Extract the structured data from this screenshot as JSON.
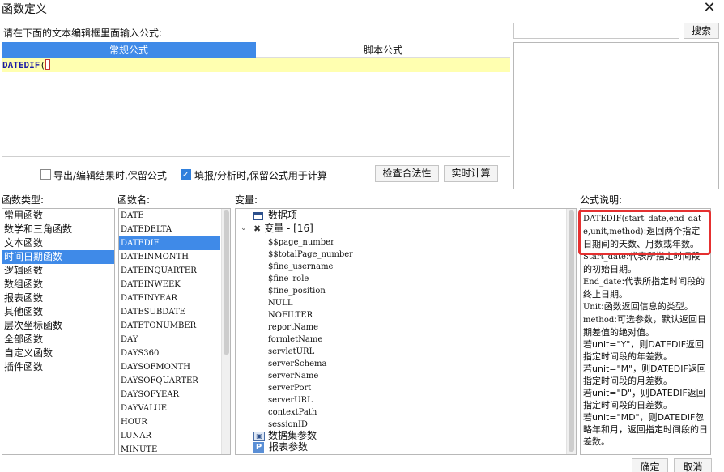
{
  "window": {
    "title": "函数定义"
  },
  "prompt": "请在下面的文本编辑框里面输入公式:",
  "search": {
    "value": "",
    "button": "搜索"
  },
  "tabs": {
    "normal": "常规公式",
    "script": "脚本公式"
  },
  "editor": {
    "function": "DATEDIF",
    "open_paren": "(",
    "close_paren": ")"
  },
  "options": {
    "keep_on_export": {
      "label": "导出/编辑结果时,保留公式",
      "checked": false
    },
    "keep_on_fill": {
      "label": "填报/分析时,保留公式用于计算",
      "checked": true
    }
  },
  "buttons": {
    "check": "检查合法性",
    "calc": "实时计算",
    "ok": "确定",
    "cancel": "取消"
  },
  "sections": {
    "type": "函数类型:",
    "name": "函数名:",
    "variable": "变量:",
    "description": "公式说明:"
  },
  "function_types": [
    "常用函数",
    "数学和三角函数",
    "文本函数",
    "时间日期函数",
    "逻辑函数",
    "数组函数",
    "报表函数",
    "其他函数",
    "层次坐标函数",
    "全部函数",
    "自定义函数",
    "插件函数"
  ],
  "selected_type_index": 3,
  "function_names": [
    "DATE",
    "DATEDELTA",
    "DATEDIF",
    "DATEINMONTH",
    "DATEINQUARTER",
    "DATEINWEEK",
    "DATEINYEAR",
    "DATESUBDATE",
    "DATETONUMBER",
    "DAY",
    "DAYS360",
    "DAYSOFMONTH",
    "DAYSOFQUARTER",
    "DAYSOFYEAR",
    "DAYVALUE",
    "HOUR",
    "LUNAR",
    "MINUTE"
  ],
  "selected_name_index": 2,
  "variables": {
    "data_item": "数据项",
    "var_group": "变量 - [16]",
    "items": [
      "$$page_number",
      "$$totalPage_number",
      "$fine_username",
      "$fine_role",
      "$fine_position",
      "NULL",
      "NOFILTER",
      "reportName",
      "formletName",
      "servletURL",
      "serverSchema",
      "serverName",
      "serverPort",
      "serverURL",
      "contextPath",
      "sessionID"
    ],
    "dataset_params": "数据集参数",
    "report_params": "报表参数"
  },
  "description": {
    "signature": "DATEDIF(start_date,end_date,unit,method)",
    "summary": ":返回两个指定日期间的天数、月数或年数。",
    "lines": [
      {
        "code": "Start_date",
        "text": ":代表所指定时间段的初始日期。"
      },
      {
        "code": "End_date",
        "text": ":代表所指定时间段的终止日期。"
      },
      {
        "code": "Unit",
        "text": ":函数返回信息的类型。"
      },
      {
        "code": "method",
        "text": ":可选参数，默认返回日期差值的绝对值。"
      },
      {
        "code": "",
        "text": "若unit=\"Y\"，则DATEDIF返回指定时间段的年差数。"
      },
      {
        "code": "",
        "text": "若unit=\"M\"，则DATEDIF返回指定时间段的月差数。"
      },
      {
        "code": "",
        "text": "若unit=\"D\"，则DATEDIF返回指定时间段的日差数。"
      },
      {
        "code": "",
        "text": "若unit=\"MD\"，则DATEDIF忽略年和月，返回指定时间段的日差数。"
      }
    ]
  },
  "colors": {
    "accent": "#3f8ae8",
    "highlight": "#ffffb0",
    "annotation": "#e53030"
  }
}
